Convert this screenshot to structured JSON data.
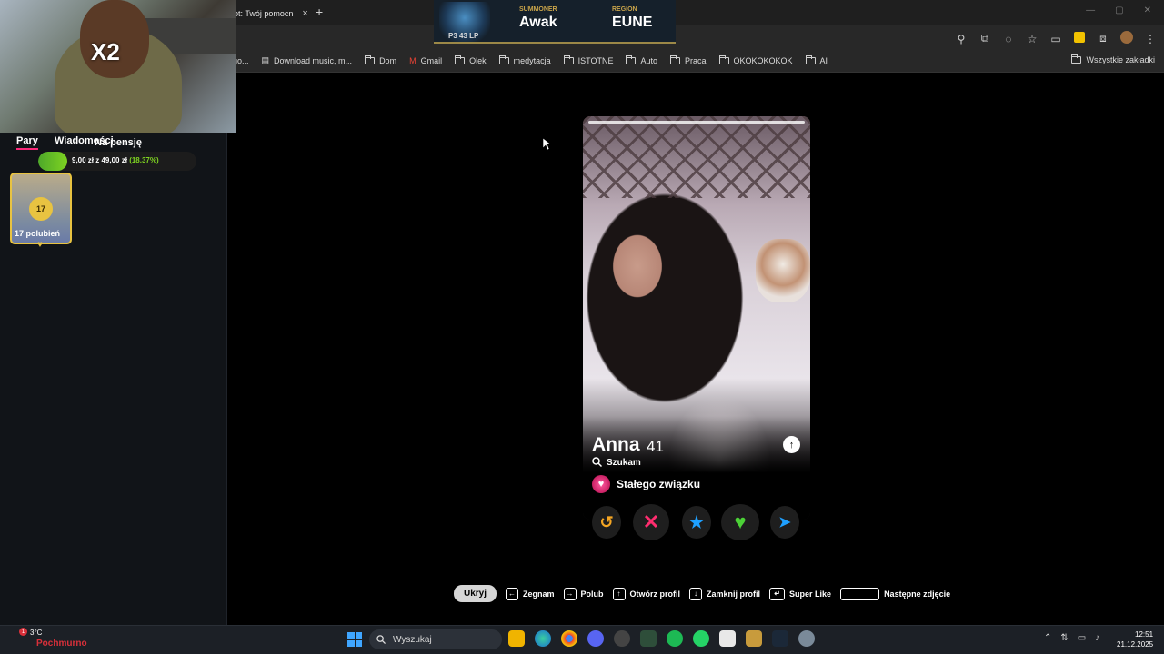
{
  "browser": {
    "tab_title": "lot: Twój pomocn",
    "tab_close": "×",
    "new_tab": "+",
    "window_controls": [
      "—",
      "▢",
      "✕"
    ],
    "bookmarks": [
      {
        "label": "go...",
        "icon": "none"
      },
      {
        "label": "Download music, m...",
        "icon": "page-icon"
      },
      {
        "label": "Dom",
        "icon": "folder-icon"
      },
      {
        "label": "Gmail",
        "icon": "gmail-icon"
      },
      {
        "label": "Olek",
        "icon": "folder-icon"
      },
      {
        "label": "medytacja",
        "icon": "folder-icon"
      },
      {
        "label": "ISTOTNE",
        "icon": "folder-icon"
      },
      {
        "label": "Auto",
        "icon": "folder-icon"
      },
      {
        "label": "Praca",
        "icon": "folder-icon"
      },
      {
        "label": "OKOKOKOKOK",
        "icon": "folder-icon"
      },
      {
        "label": "AI",
        "icon": "folder-icon"
      }
    ],
    "all_bookmarks": "Wszystkie zakładki"
  },
  "lol_overlay": {
    "rank": "P3 43 LP",
    "summoner_label": "SUMMONER",
    "summoner": "Awak",
    "region_label": "REGION",
    "region": "EUNE"
  },
  "webcam": {
    "overlay_text": "X2"
  },
  "sidebar": {
    "tabs": [
      "Pary",
      "Wiadomości"
    ],
    "goal": {
      "title": "Na pensję",
      "amount": "9,00 zł",
      "of": "z",
      "target": "49,00 zł",
      "percent": "(18.37%)",
      "progress": 0.1837
    },
    "likes": {
      "count": "17",
      "label": "17 polubień"
    }
  },
  "profile": {
    "name": "Anna",
    "age": "41",
    "searching_label": "Szukam",
    "relationship": "Stałego związku"
  },
  "hints": {
    "hide": "Ukryj",
    "items": [
      {
        "key": "←",
        "label": "Żegnam"
      },
      {
        "key": "→",
        "label": "Polub"
      },
      {
        "key": "↑",
        "label": "Otwórz profil"
      },
      {
        "key": "↓",
        "label": "Zamknij profil"
      },
      {
        "key": "↵",
        "label": "Super Like"
      },
      {
        "key": "",
        "label": "Następne zdjęcie"
      }
    ]
  },
  "taskbar": {
    "weather_temp": "3°C",
    "weather_badge": "1",
    "stream_name": "Pochmurno",
    "search": "Wyszukaj",
    "time": "12:51",
    "date": "21.12.2025"
  },
  "colors": {
    "accent_pink": "#fd297b",
    "goal_green": "#7ed321",
    "gold": "#e8c341"
  }
}
